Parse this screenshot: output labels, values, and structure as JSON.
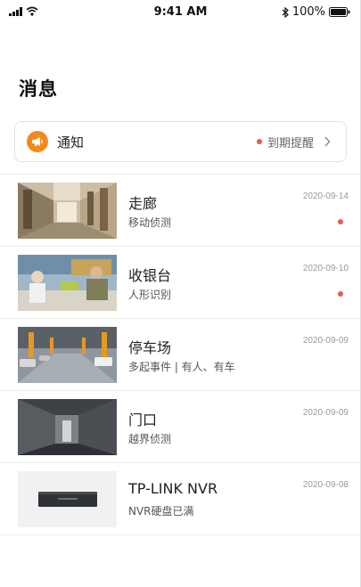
{
  "status_bar": {
    "time": "9:41 AM",
    "battery": "100%"
  },
  "page": {
    "title": "消息"
  },
  "notice": {
    "label": "通知",
    "reminder": "到期提醒",
    "icon": "megaphone-icon",
    "color": "#f28a1b"
  },
  "colors": {
    "unread_dot": "#e85c4a"
  },
  "messages": [
    {
      "title": "走廊",
      "subtitle": "移动侦测",
      "date": "2020-09-14",
      "unread": true
    },
    {
      "title": "收银台",
      "subtitle": "人形识别",
      "date": "2020-09-10",
      "unread": true
    },
    {
      "title": "停车场",
      "subtitle": "多起事件 | 有人、有车",
      "date": "2020-09-09",
      "unread": false
    },
    {
      "title": "门口",
      "subtitle": "越界侦测",
      "date": "2020-09-09",
      "unread": false
    },
    {
      "title": "TP-LINK NVR",
      "subtitle": "NVR硬盘已满",
      "date": "2020-09-08",
      "unread": false
    }
  ]
}
